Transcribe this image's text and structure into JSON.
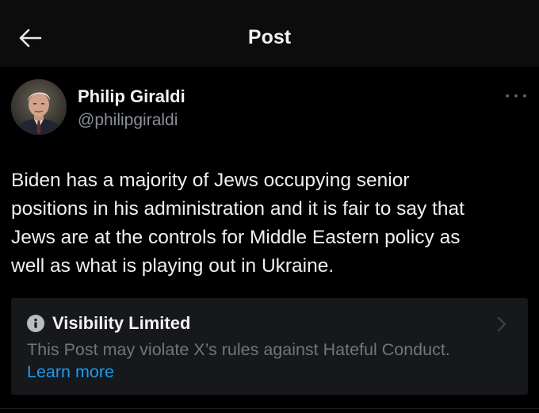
{
  "header": {
    "title": "Post",
    "back_icon": "arrow-left-icon"
  },
  "post": {
    "author": {
      "name": "Philip Giraldi",
      "handle": "@philipgiraldi",
      "avatar_icon": "avatar-photo"
    },
    "more_icon": "more-horizontal-icon",
    "text": "Biden has a majority of Jews occupying senior\npositions in his administration and it is fair to say that\nJews are at the controls for Middle Eastern policy as\nwell as what is playing out in Ukraine."
  },
  "notice": {
    "icon": "info-icon",
    "title": "Visibility Limited",
    "body": "This Post may violate X’s rules against Hateful Conduct.",
    "link_label": "Learn more",
    "chevron_icon": "chevron-right-icon"
  },
  "colors": {
    "background": "#000000",
    "header_bg": "#0c0c0c",
    "notice_bg": "#16181c",
    "primary_text": "#e7e9ea",
    "secondary_text": "#8b9096",
    "link": "#1d9bf0"
  }
}
